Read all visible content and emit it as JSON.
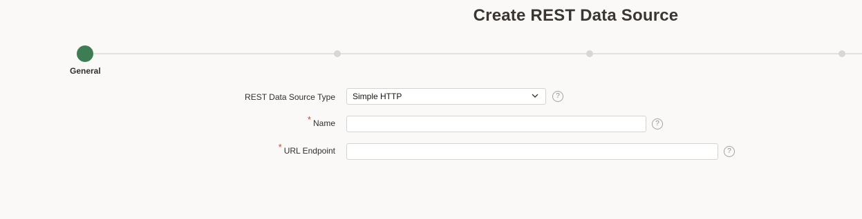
{
  "page": {
    "title": "Create REST Data Source"
  },
  "wizard": {
    "steps": [
      {
        "label": "General",
        "active": true
      },
      {
        "label": "",
        "active": false
      },
      {
        "label": "",
        "active": false
      },
      {
        "label": "",
        "active": false
      }
    ],
    "active_color": "#3e7d54"
  },
  "form": {
    "type_field": {
      "label": "REST Data Source Type",
      "value": "Simple HTTP",
      "help_icon": "?"
    },
    "name_field": {
      "label": "Name",
      "required_marker": "*",
      "value": "",
      "help_icon": "?"
    },
    "url_field": {
      "label": "URL Endpoint",
      "required_marker": "*",
      "value": "",
      "help_icon": "?"
    }
  },
  "colors": {
    "background": "#fbf9f8",
    "required": "#c74634"
  }
}
